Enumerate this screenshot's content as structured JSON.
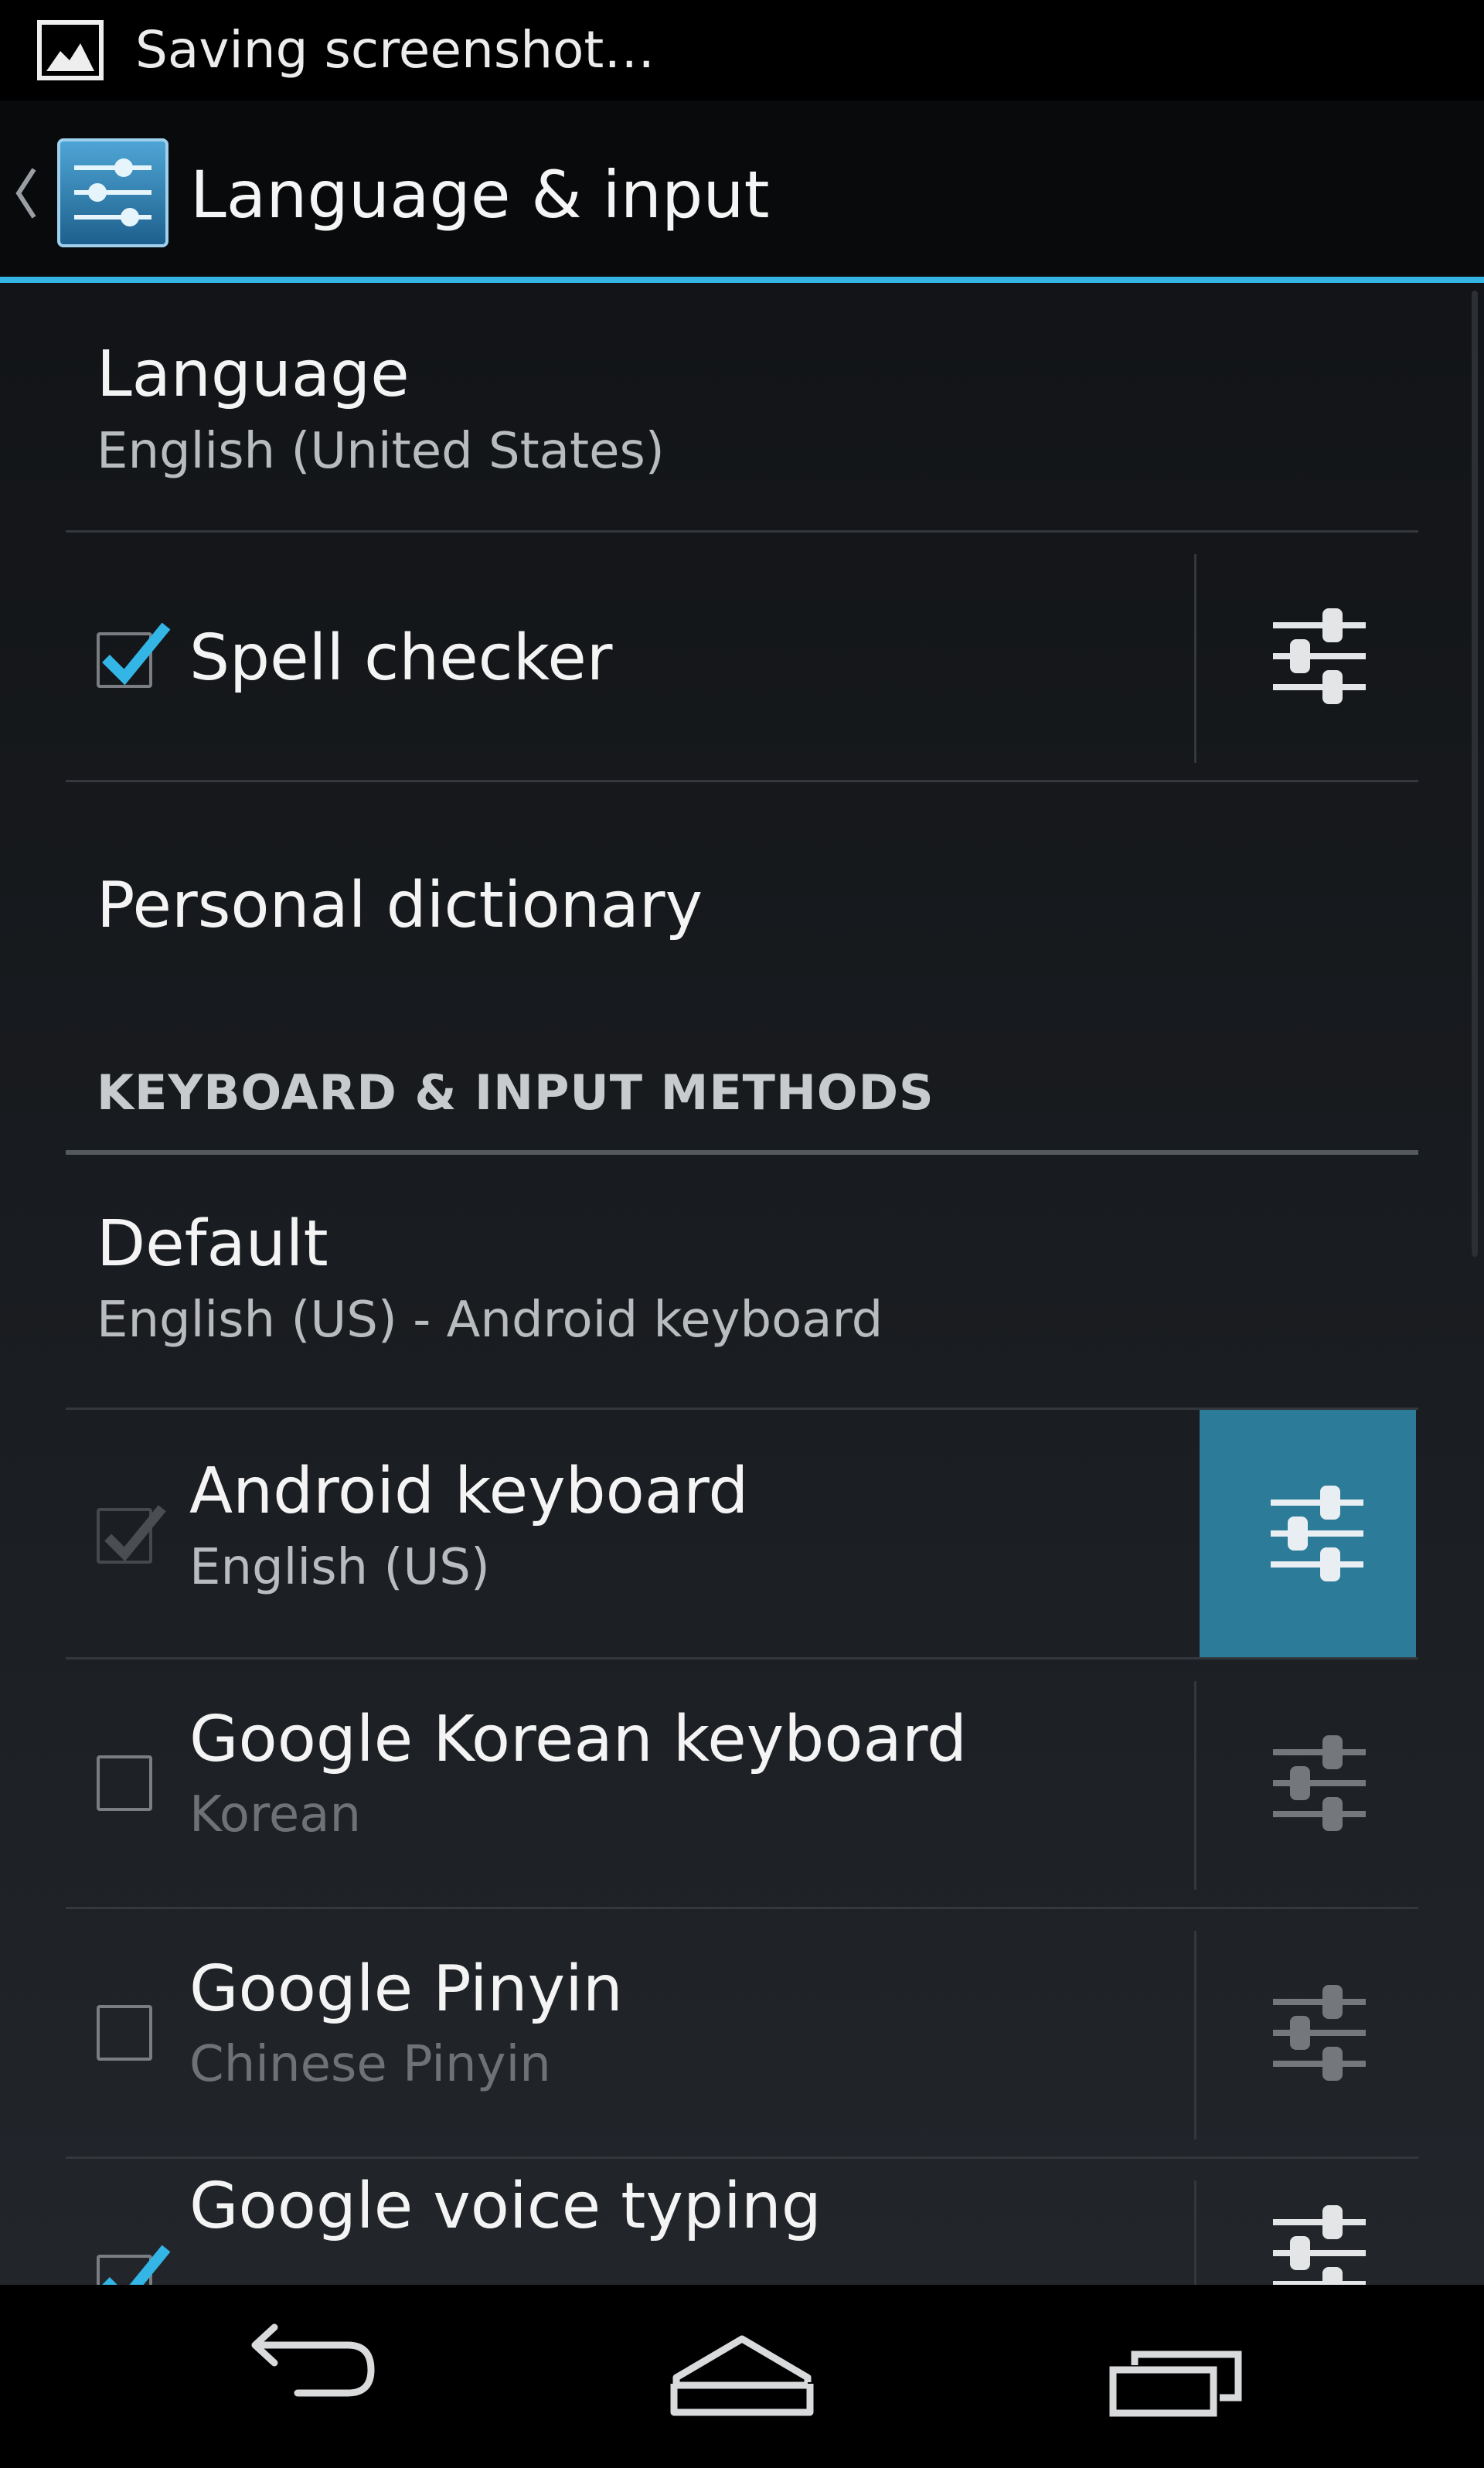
{
  "status_bar": {
    "notification_text": "Saving screenshot…",
    "icon": "image-icon"
  },
  "action_bar": {
    "title": "Language & input",
    "app_icon": "settings-sliders-icon",
    "accent_color": "#33b5e5"
  },
  "language": {
    "title": "Language",
    "summary": "English (United States)"
  },
  "spell_checker": {
    "title": "Spell checker",
    "checked": true
  },
  "personal_dictionary": {
    "title": "Personal dictionary"
  },
  "section_header": "KEYBOARD & INPUT METHODS",
  "default_method": {
    "title": "Default",
    "summary": "English (US) - Android keyboard"
  },
  "input_methods": [
    {
      "title": "Android keyboard",
      "summary": "English (US)",
      "checked": true,
      "enabled": false,
      "settings_pressed": true
    },
    {
      "title": "Google Korean keyboard",
      "summary": "Korean",
      "checked": false,
      "enabled": true
    },
    {
      "title": "Google Pinyin",
      "summary": "Chinese Pinyin",
      "checked": false,
      "enabled": true
    },
    {
      "title": "Google voice typing",
      "checked": true,
      "enabled": true
    }
  ],
  "nav_bar": {
    "back": "back-icon",
    "home": "home-icon",
    "recents": "recents-icon"
  }
}
